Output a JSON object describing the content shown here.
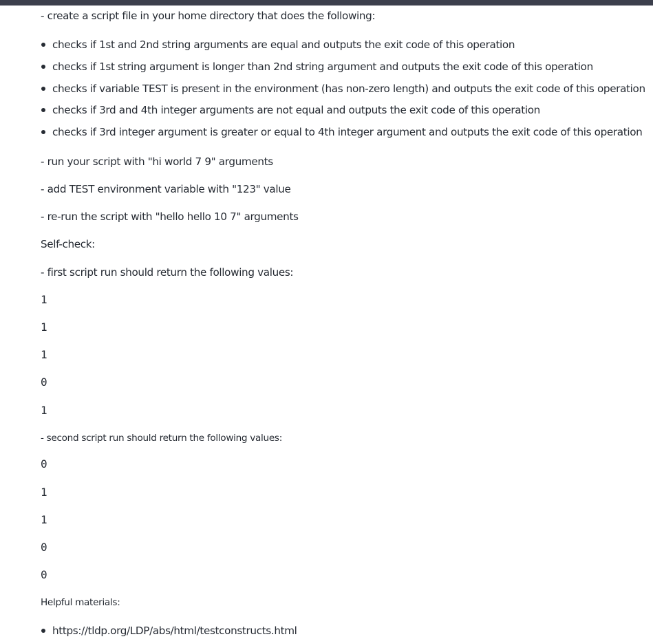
{
  "intro": "- create a script file in your home directory that does the following:",
  "checks": [
    "checks if 1st and 2nd string arguments are equal and outputs the exit code of this operation",
    "checks if 1st string argument is longer than 2nd string argument and outputs the exit code of this operation",
    "checks if variable TEST is present in the environment (has non-zero length) and outputs the exit code of this operation",
    "checks if 3rd and 4th integer arguments are not equal and outputs the exit code of this operation",
    "checks if 3rd integer argument is greater or equal to 4th integer argument and outputs the exit code of this operation"
  ],
  "steps": [
    "- run your script with \"hi world 7 9\" arguments",
    "- add TEST environment variable with \"123\" value",
    "- re-run the script with \"hello hello 10 7\" arguments"
  ],
  "self_check_heading": "Self-check:",
  "first_run_label": "- first script run should return the following values:",
  "first_run_values": [
    "1",
    "1",
    "1",
    "0",
    "1"
  ],
  "second_run_label": "- second script run should return the following values:",
  "second_run_values": [
    "0",
    "1",
    "1",
    "0",
    "0"
  ],
  "materials_heading": "Helpful materials:",
  "materials": [
    "https://tldp.org/LDP/abs/html/testconstructs.html"
  ]
}
